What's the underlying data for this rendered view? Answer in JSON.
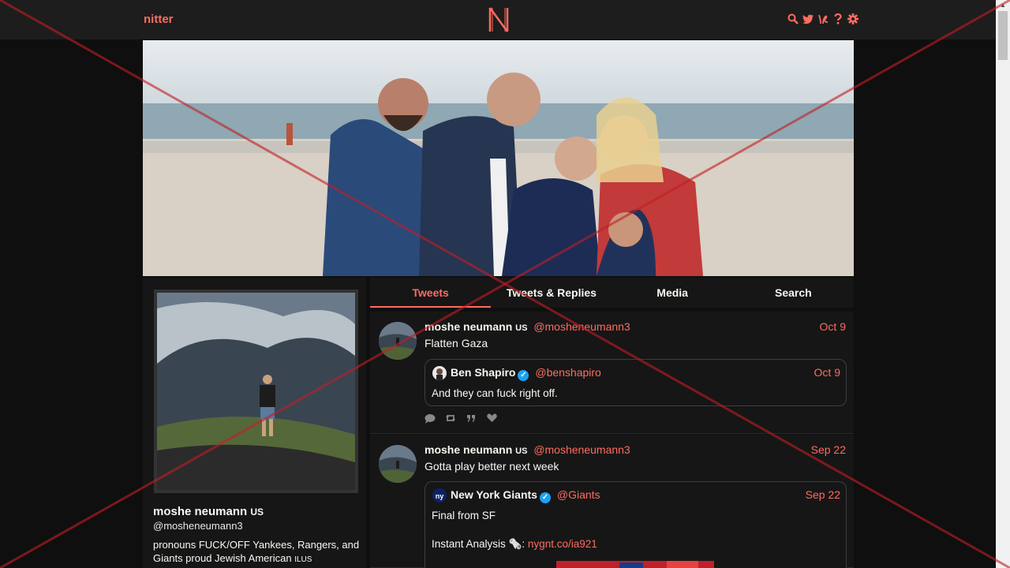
{
  "nav": {
    "brand": "nitter",
    "logo_letter": "N",
    "icons": [
      "search-icon",
      "twitter-bird-icon",
      "rss-icon",
      "help-icon",
      "gear-icon"
    ]
  },
  "colors": {
    "accent": "#ff6c60",
    "background": "#0f0f0f",
    "panel": "#161616",
    "verified": "#1da1f2",
    "overlay": "#c21e24"
  },
  "profile": {
    "fullname": "moshe neumann",
    "flag": "US",
    "handle": "@mosheneumann3",
    "bio": "pronouns FUCK/OFF Yankees, Rangers, and Giants proud Jewish American",
    "bio_flags": "ILUS"
  },
  "tabs": [
    {
      "label": "Tweets",
      "active": true
    },
    {
      "label": "Tweets & Replies",
      "active": false
    },
    {
      "label": "Media",
      "active": false
    },
    {
      "label": "Search",
      "active": false
    }
  ],
  "tweets": [
    {
      "fullname": "moshe neumann",
      "flag": "US",
      "username": "@mosheneumann3",
      "date": "Oct 9",
      "text": "Flatten Gaza",
      "quote": {
        "fullname": "Ben Shapiro",
        "username": "@benshapiro",
        "date": "Oct 9",
        "text": "And they can fuck right off."
      }
    },
    {
      "fullname": "moshe neumann",
      "flag": "US",
      "username": "@mosheneumann3",
      "date": "Sep 22",
      "text": "Gotta play better next week",
      "quote": {
        "fullname": "New York Giants",
        "username": "@Giants",
        "date": "Sep 22",
        "text": "Final from SF",
        "text2_prefix": "Instant Analysis",
        "text2_emoji": "🗞️",
        "text2_colon": ":",
        "link": "nygnt.co/ia921"
      }
    }
  ]
}
